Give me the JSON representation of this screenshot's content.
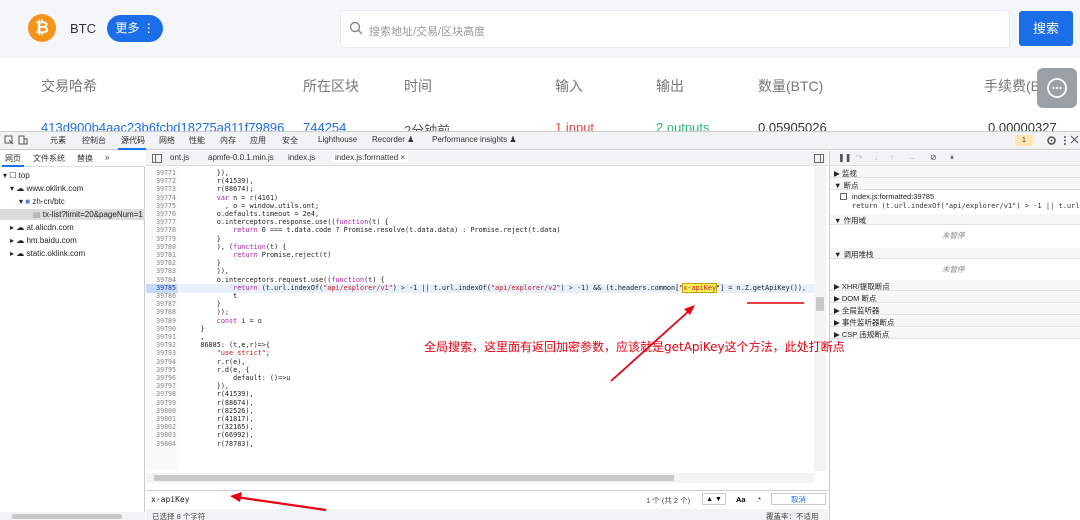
{
  "site": {
    "coin": "BTC",
    "more_button": "更多 ⋮",
    "search_placeholder": "搜索地址/交易/区块高度",
    "search_button": "搜索",
    "columns": [
      "交易哈希",
      "所在区块",
      "时间",
      "输入",
      "输出",
      "数量(BTC)",
      "手续费(BTC)"
    ],
    "row": {
      "hash": "413d900b4aac23b6fcbd18275a811f79896",
      "block": "744254",
      "time": "2分钟前",
      "inputs": "1 input",
      "outputs": "2 outputs",
      "amount": "0.05905026",
      "fee": "0.00000327"
    },
    "colors": {
      "accent": "#1b6ee8",
      "bitcoin": "#f7931a",
      "input": "#e5484d",
      "output": "#2eb872"
    }
  },
  "devtools": {
    "tabs": [
      "元素",
      "控制台",
      "源代码",
      "网络",
      "性能",
      "内存",
      "应用",
      "安全",
      "Lighthouse",
      "Recorder ♟",
      "Performance insights ♟"
    ],
    "active_tab": "源代码",
    "issue_count": "1",
    "navigator_tabs": [
      "网页",
      "文件系统",
      "替换",
      "»"
    ],
    "tree": [
      {
        "label": "top",
        "depth": 0,
        "icon": "frame-icon"
      },
      {
        "label": "www.oklink.com",
        "depth": 1,
        "icon": "cloud-icon"
      },
      {
        "label": "zh-cn/btc",
        "depth": 2,
        "icon": "folder-icon"
      },
      {
        "label": "tx-list?limit=20&pageNum=1",
        "depth": 3,
        "icon": "file-icon"
      },
      {
        "label": "at.alicdn.com",
        "depth": 1,
        "icon": "cloud-icon"
      },
      {
        "label": "hm.baidu.com",
        "depth": 1,
        "icon": "cloud-icon"
      },
      {
        "label": "static.oklink.com",
        "depth": 1,
        "icon": "cloud-icon"
      }
    ],
    "file_tabs": [
      "ont.js",
      "apmfe-0.0.1.min.js",
      "index.js",
      "index.js:formatted ×"
    ],
    "active_file": "index.js:formatted ×",
    "code_lines": [
      {
        "n": "39771",
        "text": "        }),"
      },
      {
        "n": "39772",
        "text": "        r(41539),"
      },
      {
        "n": "39773",
        "text": "        r(88674);"
      },
      {
        "n": "39774",
        "text": "        var n = r(4161)"
      },
      {
        "n": "39775",
        "text": "          , o = window.utils.ont;"
      },
      {
        "n": "39776",
        "text": "        o.defaults.timeout = 2e4,"
      },
      {
        "n": "39777",
        "text": "        o.interceptors.response.use((function(t) {"
      },
      {
        "n": "39778",
        "text": "            return 0 === t.data.code ? Promise.resolve(t.data.data) : Promise.reject(t.data)"
      },
      {
        "n": "39779",
        "text": "        }"
      },
      {
        "n": "39780",
        "text": "        ), (function(t) {"
      },
      {
        "n": "39781",
        "text": "            return Promise.reject(t)"
      },
      {
        "n": "39782",
        "text": "        }"
      },
      {
        "n": "39783",
        "text": "        )),"
      },
      {
        "n": "39784",
        "text": "        o.interceptors.request.use((function(t) {"
      },
      {
        "n": "39785",
        "text": "            return (t.url.indexOf(\"api/explorer/v1\") > -1 || t.url.indexOf(\"api/explorer/v2\") > -1) && (t.headers.common[\"",
        "highlight": "x-apiKey",
        "tail": "\"] = n.Z.getApiKey()),",
        "breakpoint": true
      },
      {
        "n": "39786",
        "text": "            t"
      },
      {
        "n": "39787",
        "text": "        }"
      },
      {
        "n": "39788",
        "text": "        ));"
      },
      {
        "n": "39789",
        "text": "        const i = o"
      },
      {
        "n": "39790",
        "text": "    }"
      },
      {
        "n": "39791",
        "text": "    ,"
      },
      {
        "n": "39792",
        "text": "    86085: (t,e,r)=>{"
      },
      {
        "n": "39793",
        "text": "        \"use strict\";"
      },
      {
        "n": "39794",
        "text": "        r.r(e),"
      },
      {
        "n": "39795",
        "text": "        r.d(e, {"
      },
      {
        "n": "39796",
        "text": "            default: ()=>u"
      },
      {
        "n": "39797",
        "text": "        }),"
      },
      {
        "n": "39798",
        "text": "        r(41539),"
      },
      {
        "n": "39799",
        "text": "        r(88674),"
      },
      {
        "n": "39800",
        "text": "        r(82526),"
      },
      {
        "n": "39801",
        "text": "        r(41817),"
      },
      {
        "n": "39802",
        "text": "        r(32165),"
      },
      {
        "n": "39803",
        "text": "        r(66992),"
      },
      {
        "n": "39804",
        "text": "        r(78783),"
      }
    ],
    "find": {
      "query": "x-apiKey",
      "result": "1 个 (共 2 个)",
      "case_toggle": "Aa",
      "regex_toggle": ".*",
      "cancel": "取消"
    },
    "status": {
      "selected": "已选择 8 个字符",
      "coverage": "覆盖率：不适用"
    },
    "debug_sections": [
      {
        "label": "▶ 监视"
      },
      {
        "label": "▼ 断点"
      },
      {
        "label": "▼ 作用域"
      },
      {
        "label": "▼ 调用堆栈"
      },
      {
        "label": "▶ XHR/提取断点"
      },
      {
        "label": "▶ DOM 断点"
      },
      {
        "label": "▶ 全局监听器"
      },
      {
        "label": "▶ 事件监听器断点"
      },
      {
        "label": "▶ CSP 违规断点"
      }
    ],
    "breakpoint_file": "index.js:formatted:39785",
    "breakpoint_code": "return (t.url.indexOf(\"api/explorer/v1\") > -1 || t.url",
    "not_paused": "未暂停"
  },
  "annotation": "全局搜索，这里面有返回加密参数，应该就是getApiKey这个方法，此处打断点"
}
